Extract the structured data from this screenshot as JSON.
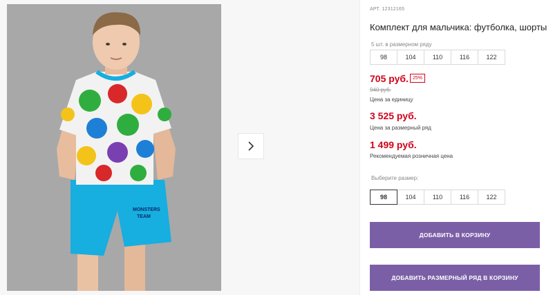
{
  "product": {
    "sku": "АРТ. 12312165",
    "title": "Комплект для мальчика: футболка, шорты",
    "size_row_label": "5 шт. в размерном ряду",
    "sizes": [
      "98",
      "104",
      "110",
      "116",
      "122"
    ],
    "price": "705 руб.",
    "discount": "25%",
    "old_price": "940 руб.",
    "per_unit_label": "Цена за единицу",
    "series_price": "3 525 руб.",
    "series_label": "Цена за размерный ряд",
    "retail_price": "1 499 руб.",
    "retail_label": "Рекомендуемая розничная цена",
    "choose_size_label": "Выберите размер:",
    "selected_size": "98"
  },
  "buttons": {
    "add_to_cart": "ДОБАВИТЬ В КОРЗИНУ",
    "add_series_to_cart": "ДОБАВИТЬ РАЗМЕРНЫЙ РЯД В КОРЗИНУ"
  },
  "gallery": {
    "next_icon": "chevron-right-icon",
    "print_text": "MONSTERS TEAM"
  },
  "colors": {
    "price_red": "#d0021b",
    "button_purple": "#7b5fa6",
    "photo_bg": "#a9a9a9",
    "shorts_blue": "#17aee0"
  }
}
